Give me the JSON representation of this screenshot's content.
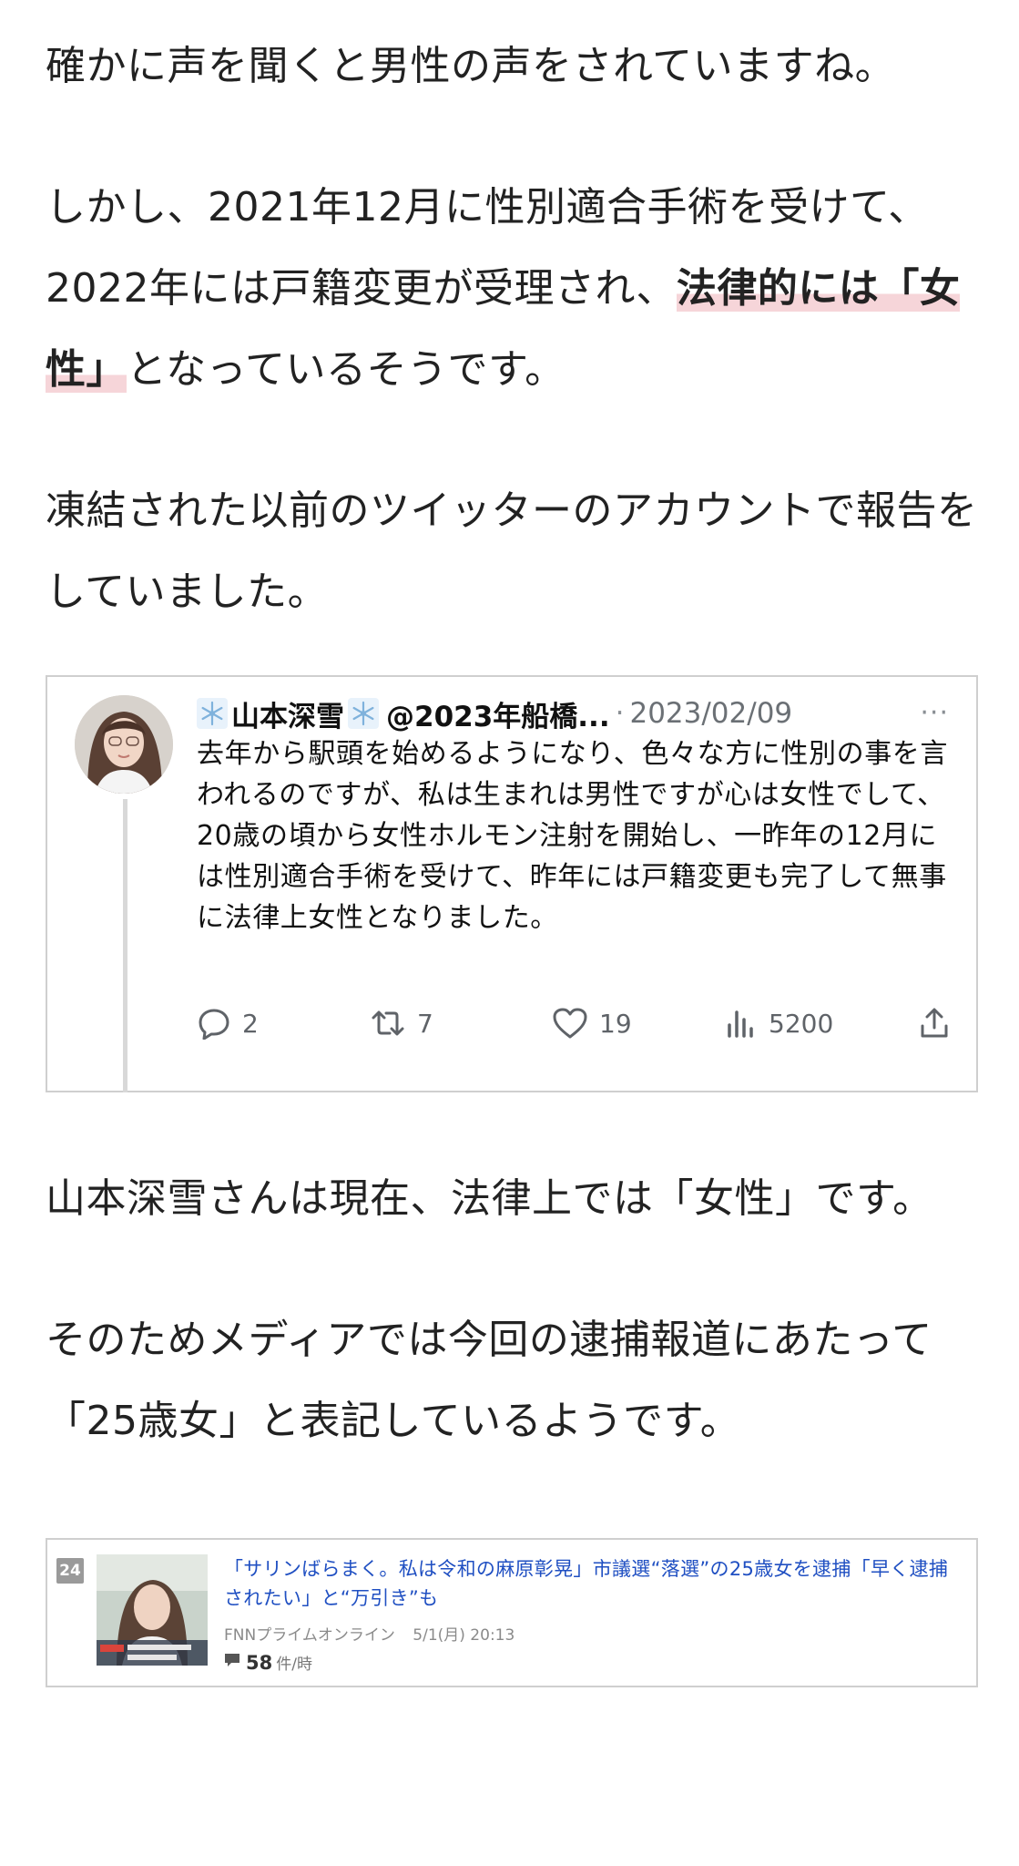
{
  "article": {
    "p1": "確かに声を聞くと男性の声をされていますね。",
    "p2_before": "しかし、2021年12月に性別適合手術を受けて、2022年には戸籍変更が受理され、",
    "p2_highlight_line1": "法律的",
    "p2_highlight_line2": "には「女性」",
    "p2_after": "となっているそうです。",
    "p3": "凍結された以前のツイッターのアカウントで報告をしていました。",
    "p4": "山本深雪さんは現在、法律上では「女性」です。",
    "p5": "そのためメディアでは今回の逮捕報道にあたって「25歳女」と表記しているようです。"
  },
  "tweet": {
    "display_name": "山本深雪",
    "handle": "@2023年船橋...",
    "separator": "·",
    "date": "2023/02/09",
    "more_icon": "···",
    "body": "去年から駅頭を始めるようになり、色々な方に性別の事を言われるのですが、私は生まれは男性ですが心は女性でして、20歳の頃から女性ホルモン注射を開始し、一昨年の12月には性別適合手術を受けて、昨年には戸籍変更も完了して無事に法律上女性となりました。",
    "replies": "2",
    "retweets": "7",
    "likes": "19",
    "views": "5200"
  },
  "news": {
    "rank": "24",
    "headline": "「サリンばらまく。私は令和の麻原彰晃」市議選“落選”の25歳女を逮捕「早く逮捕されたい」と“万引き”も",
    "source": "FNNプライムオンライン",
    "timestamp": "5/1(月) 20:13",
    "comment_count": "58",
    "comment_unit": "件/時"
  },
  "colors": {
    "highlight": "#f6d5d9",
    "link": "#1f4fc2",
    "border": "#cfcfcf",
    "thread_line": "#d8d8d8"
  }
}
